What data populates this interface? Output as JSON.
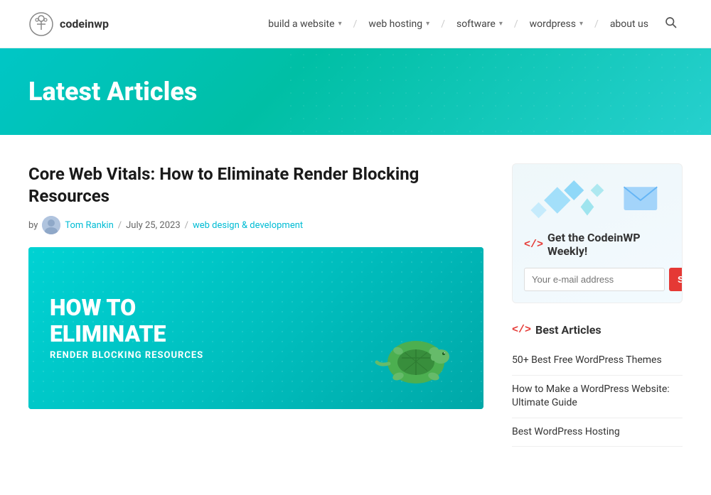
{
  "header": {
    "logo_text": "codeinwp",
    "nav": [
      {
        "label": "build a website",
        "has_dropdown": true
      },
      {
        "label": "web hosting",
        "has_dropdown": true
      },
      {
        "label": "software",
        "has_dropdown": true
      },
      {
        "label": "wordpress",
        "has_dropdown": true
      },
      {
        "label": "about us",
        "has_dropdown": false
      }
    ]
  },
  "hero": {
    "title": "Latest Articles"
  },
  "article": {
    "title": "Core Web Vitals: How to Eliminate Render Blocking Resources",
    "meta_by": "by",
    "author": "Tom Rankin",
    "date": "July 25, 2023",
    "category": "web design & development",
    "image_line1": "HOW TO",
    "image_line2": "ELIMINATE",
    "image_line3": "RENDER BLOCKING RESOURCES"
  },
  "sidebar": {
    "newsletter": {
      "tag": "</>",
      "title": "Get the CodeinWP Weekly!",
      "email_placeholder": "Your e-mail address",
      "subscribe_label": "Subscribe"
    },
    "best_articles": {
      "tag": "</>",
      "title": "Best Articles",
      "links": [
        "50+ Best Free WordPress Themes",
        "How to Make a WordPress Website: Ultimate Guide",
        "Best WordPress Hosting"
      ]
    }
  }
}
